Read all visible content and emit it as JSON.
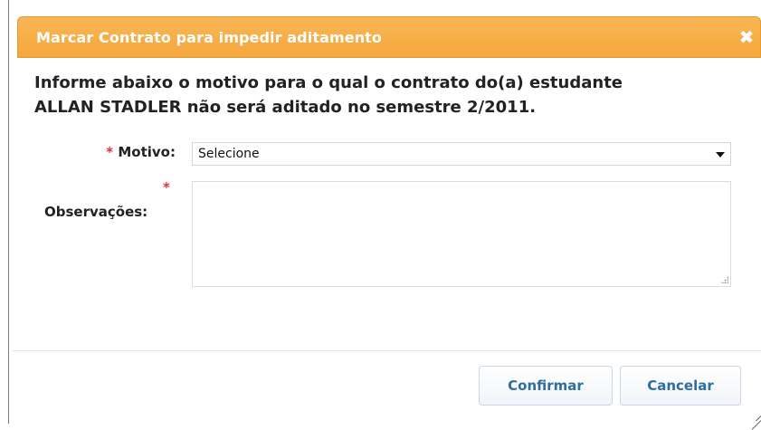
{
  "dialog": {
    "title": "Marcar Contrato para impedir aditamento",
    "close_icon": "close-icon",
    "close_symbol": "✖",
    "message_line_1": "Informe abaixo o motivo para o qual o contrato do(a) estudante",
    "message_line_2": "ALLAN STADLER não será aditado no semestre 2/2011.",
    "required_marker": "*",
    "motivo_label": "Motivo:",
    "motivo_selected": "Selecione",
    "observacoes_label": "Observações:",
    "observacoes_value": "",
    "confirm_label": "Confirmar",
    "cancel_label": "Cancelar"
  },
  "colors": {
    "title_bar": "#f5a73b",
    "required_marker": "#e0323e",
    "button_text": "#2e6e9e"
  }
}
